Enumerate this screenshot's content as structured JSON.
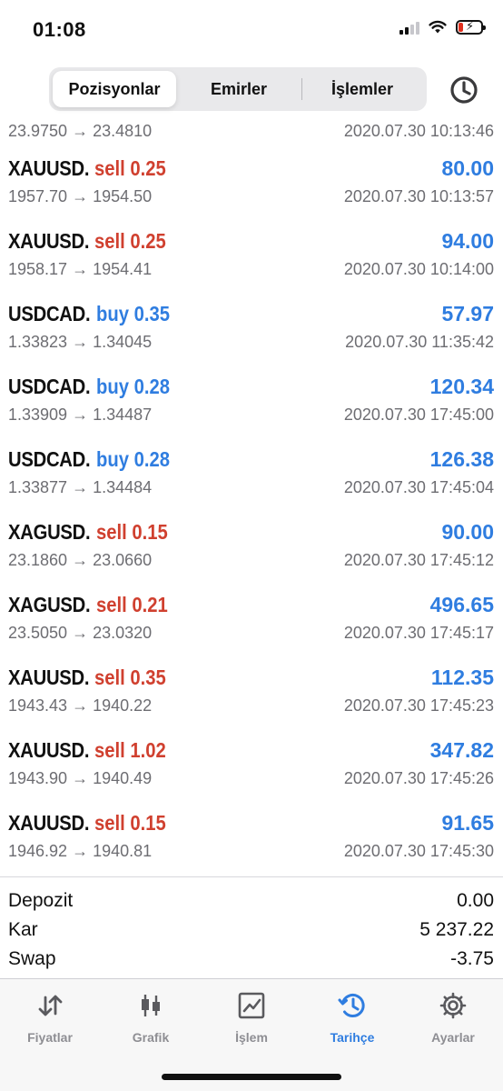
{
  "status_bar": {
    "time": "01:08"
  },
  "segments": {
    "tabs": [
      "Pozisyonlar",
      "Emirler",
      "İşlemler"
    ],
    "active_index": 0
  },
  "partial_row": {
    "prices": "23.9750 → 23.4810",
    "time": "2020.07.30 10:13:46"
  },
  "trades": [
    {
      "symbol": "XAUUSD.",
      "side_volume": "sell 0.25",
      "side": "sell",
      "profit": "80.00",
      "prices": "1957.70 → 1954.50",
      "time": "2020.07.30 10:13:57"
    },
    {
      "symbol": "XAUUSD.",
      "side_volume": "sell 0.25",
      "side": "sell",
      "profit": "94.00",
      "prices": "1958.17 → 1954.41",
      "time": "2020.07.30 10:14:00"
    },
    {
      "symbol": "USDCAD.",
      "side_volume": "buy 0.35",
      "side": "buy",
      "profit": "57.97",
      "prices": "1.33823 → 1.34045",
      "time": "2020.07.30 11:35:42"
    },
    {
      "symbol": "USDCAD.",
      "side_volume": "buy 0.28",
      "side": "buy",
      "profit": "120.34",
      "prices": "1.33909 → 1.34487",
      "time": "2020.07.30 17:45:00"
    },
    {
      "symbol": "USDCAD.",
      "side_volume": "buy 0.28",
      "side": "buy",
      "profit": "126.38",
      "prices": "1.33877 → 1.34484",
      "time": "2020.07.30 17:45:04"
    },
    {
      "symbol": "XAGUSD.",
      "side_volume": "sell 0.15",
      "side": "sell",
      "profit": "90.00",
      "prices": "23.1860 → 23.0660",
      "time": "2020.07.30 17:45:12"
    },
    {
      "symbol": "XAGUSD.",
      "side_volume": "sell 0.21",
      "side": "sell",
      "profit": "496.65",
      "prices": "23.5050 → 23.0320",
      "time": "2020.07.30 17:45:17"
    },
    {
      "symbol": "XAUUSD.",
      "side_volume": "sell 0.35",
      "side": "sell",
      "profit": "112.35",
      "prices": "1943.43 → 1940.22",
      "time": "2020.07.30 17:45:23"
    },
    {
      "symbol": "XAUUSD.",
      "side_volume": "sell 1.02",
      "side": "sell",
      "profit": "347.82",
      "prices": "1943.90 → 1940.49",
      "time": "2020.07.30 17:45:26"
    },
    {
      "symbol": "XAUUSD.",
      "side_volume": "sell 0.15",
      "side": "sell",
      "profit": "91.65",
      "prices": "1946.92 → 1940.81",
      "time": "2020.07.30 17:45:30"
    }
  ],
  "summary": [
    {
      "label": "Depozit",
      "value": "0.00"
    },
    {
      "label": "Kar",
      "value": "5 237.22"
    },
    {
      "label": "Swap",
      "value": "-3.75"
    }
  ],
  "tab_bar": {
    "items": [
      {
        "label": "Fiyatlar",
        "icon": "arrows-up-down-icon"
      },
      {
        "label": "Grafik",
        "icon": "candlestick-icon"
      },
      {
        "label": "İşlem",
        "icon": "trade-chart-icon"
      },
      {
        "label": "Tarihçe",
        "icon": "history-icon"
      },
      {
        "label": "Ayarlar",
        "icon": "gear-icon"
      }
    ],
    "active_index": 3
  },
  "colors": {
    "sell": "#d0402f",
    "buy": "#2f7de0",
    "accent": "#2f7de0",
    "inactive": "#8e8e93"
  }
}
